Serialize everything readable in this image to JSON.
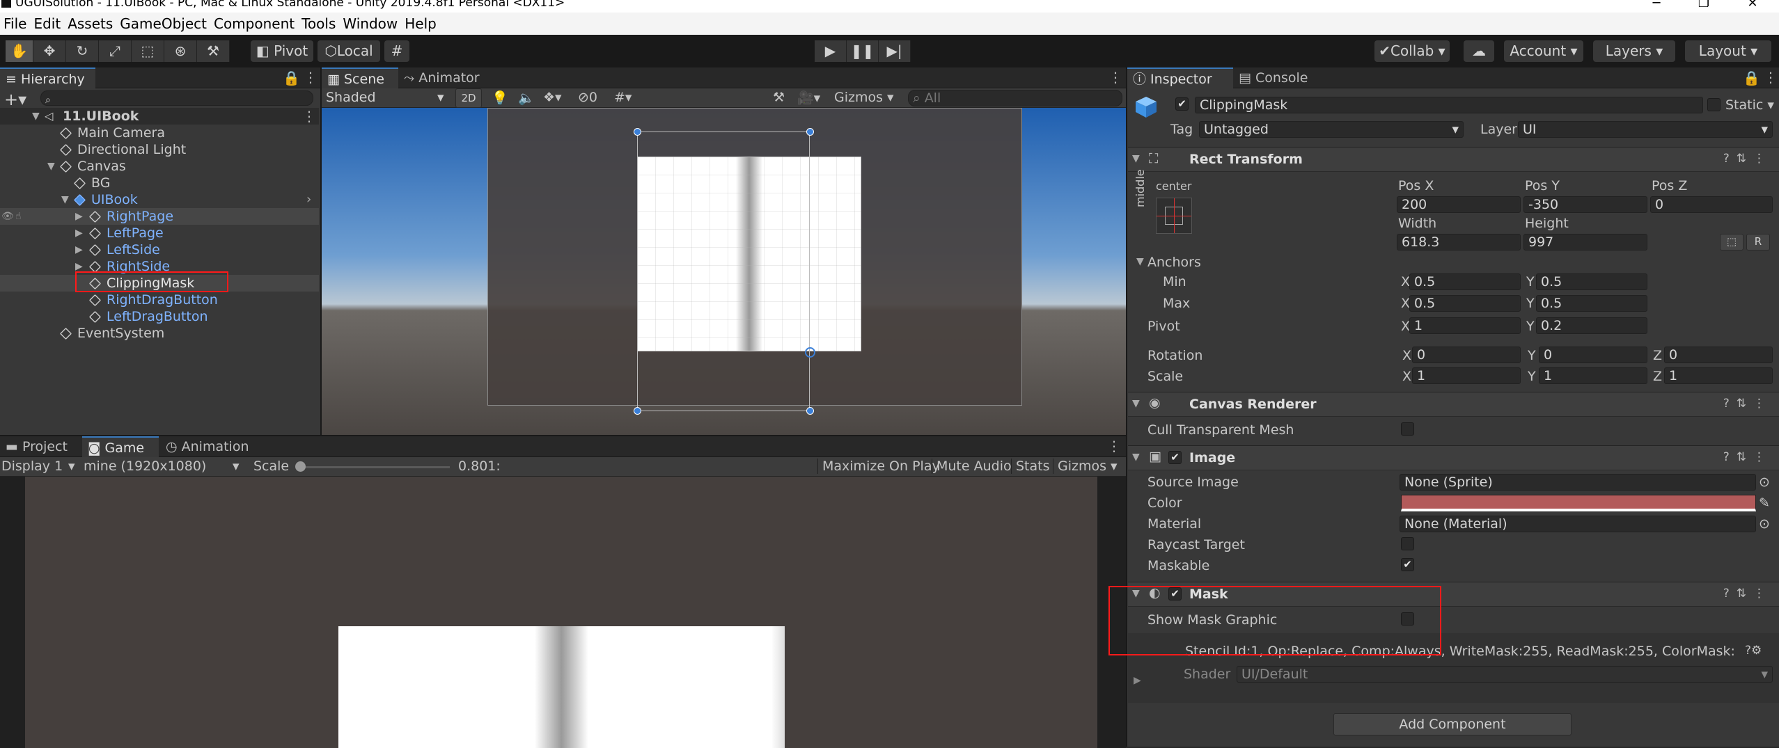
{
  "window": {
    "title": "UGUISolution - 11.UIBook - PC, Mac & Linux Standalone - Unity 2019.4.8f1 Personal <DX11>"
  },
  "menu": [
    "File",
    "Edit",
    "Assets",
    "GameObject",
    "Component",
    "Tools",
    "Window",
    "Help"
  ],
  "toolbar": {
    "pivot_label": "Pivot",
    "local_label": "Local",
    "collab_label": "Collab",
    "account_label": "Account",
    "layers_label": "Layers",
    "layout_label": "Layout"
  },
  "hierarchy": {
    "tab_label": "Hierarchy",
    "search_placeholder": "",
    "scene_name": "11.UIBook",
    "items": [
      {
        "label": "Main Camera"
      },
      {
        "label": "Directional Light"
      },
      {
        "label": "Canvas"
      },
      {
        "label": "BG"
      },
      {
        "label": "UIBook"
      },
      {
        "label": "RightPage"
      },
      {
        "label": "LeftPage"
      },
      {
        "label": "LeftSide"
      },
      {
        "label": "RightSide"
      },
      {
        "label": "ClippingMask"
      },
      {
        "label": "RightDragButton"
      },
      {
        "label": "LeftDragButton"
      },
      {
        "label": "EventSystem"
      }
    ]
  },
  "scene": {
    "tab_scene": "Scene",
    "tab_animator": "Animator",
    "shading": "Shaded",
    "mode_2d": "2D",
    "hidden_count": "0",
    "gizmos": "Gizmos",
    "search_placeholder": "All"
  },
  "game": {
    "tab_project": "Project",
    "tab_game": "Game",
    "tab_animation": "Animation",
    "display": "Display 1",
    "resolution": "mine (1920x1080)",
    "scale_label": "Scale",
    "scale_value": "0.801:",
    "scale_fraction": 0.0,
    "maximize": "Maximize On Play",
    "mute": "Mute Audio",
    "stats": "Stats",
    "gizmos": "Gizmos"
  },
  "inspector": {
    "tab_inspector": "Inspector",
    "tab_console": "Console",
    "object_name": "ClippingMask",
    "static_label": "Static",
    "tag_label": "Tag",
    "tag_value": "Untagged",
    "layer_label": "Layer",
    "layer_value": "UI",
    "rect_transform": {
      "title": "Rect Transform",
      "anchor_h": "center",
      "anchor_v": "middle",
      "pos_x_label": "Pos X",
      "pos_x": "200",
      "pos_y_label": "Pos Y",
      "pos_y": "-350",
      "pos_z_label": "Pos Z",
      "pos_z": "0",
      "width_label": "Width",
      "width": "618.3",
      "height_label": "Height",
      "height": "997",
      "anchors_label": "Anchors",
      "min_label": "Min",
      "min_x": "0.5",
      "min_y": "0.5",
      "max_label": "Max",
      "max_x": "0.5",
      "max_y": "0.5",
      "pivot_label": "Pivot",
      "pivot_x": "1",
      "pivot_y": "0.2",
      "rotation_label": "Rotation",
      "rot_x": "0",
      "rot_y": "0",
      "rot_z": "0",
      "scale_label": "Scale",
      "scale_x": "1",
      "scale_y": "1",
      "scale_z": "1",
      "x": "X",
      "y": "Y",
      "z": "Z",
      "r": "R"
    },
    "canvas_renderer": {
      "title": "Canvas Renderer",
      "cull_label": "Cull Transparent Mesh"
    },
    "image": {
      "title": "Image",
      "source_label": "Source Image",
      "source_value": "None (Sprite)",
      "color_label": "Color",
      "color_value": "#b35a5a",
      "material_label": "Material",
      "material_value": "None (Material)",
      "raycast_label": "Raycast Target",
      "maskable_label": "Maskable"
    },
    "mask": {
      "title": "Mask",
      "show_graphic_label": "Show Mask Graphic",
      "stencil_text": "Stencil Id:1, Op:Replace, Comp:Always, WriteMask:255, ReadMask:255, ColorMask:",
      "shader_label": "Shader",
      "shader_value": "UI/Default"
    },
    "add_component": "Add Component"
  },
  "colors": {
    "accent": "#3a79bb",
    "highlight_box": "#ff1a1a",
    "prefab_text": "#7fb3ff"
  }
}
